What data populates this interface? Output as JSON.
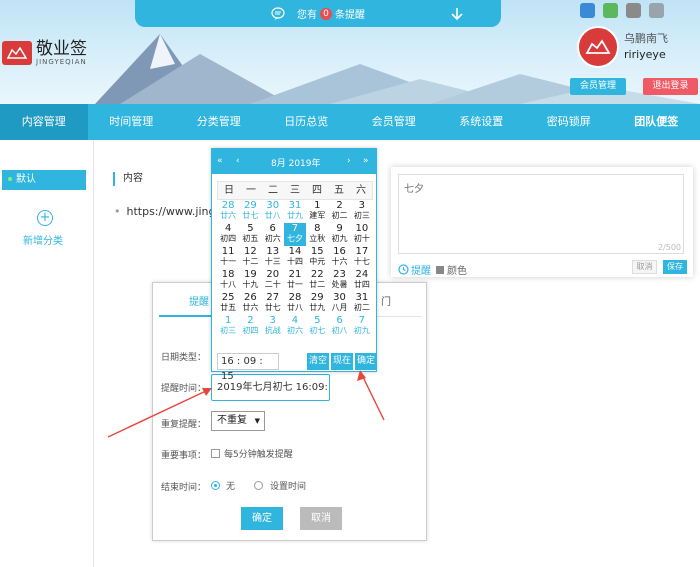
{
  "header": {
    "notice_prefix": "您有",
    "notice_count": "0",
    "notice_suffix": "条提醒",
    "logo_cn": "敬业签",
    "logo_en": "JINGYEQIAN",
    "user_name": "乌鹏南飞",
    "user_id": "ririyeye",
    "member_btn": "会员管理",
    "logout_btn": "退出登录"
  },
  "nav": {
    "items": [
      "内容管理",
      "时间管理",
      "分类管理",
      "日历总览",
      "会员管理",
      "系统设置",
      "密码锁屏",
      "团队便签"
    ]
  },
  "sidebar": {
    "default_label": "默认",
    "add_label": "新增分类"
  },
  "content": {
    "header": "内容",
    "url": "https://www.jingye"
  },
  "editor": {
    "placeholder": "七夕",
    "counter": "2/500",
    "remind": "提醒",
    "color": "颜色",
    "cancel": "取消",
    "save": "保存"
  },
  "dialog": {
    "tab1": "提醒",
    "tab2": "门",
    "date_type_label": "日期类型：",
    "remind_time_label": "提醒时间：",
    "remind_time_value": "2019年七月初七 16:09:15",
    "repeat_label": "重复提醒：",
    "repeat_value": "不重复",
    "important_label": "重要事项：",
    "important_option": "每5分钟触发提醒",
    "end_label": "结束时间：",
    "end_none": "无",
    "end_set": "设置时间",
    "ok": "确定",
    "cancel": "取消"
  },
  "calendar": {
    "month_title": "8月 2019年",
    "weekdays": [
      "日",
      "一",
      "二",
      "三",
      "四",
      "五",
      "六"
    ],
    "weeks": [
      [
        [
          "28",
          "廿六",
          "o"
        ],
        [
          "29",
          "廿七",
          "o"
        ],
        [
          "30",
          "廿八",
          "o"
        ],
        [
          "31",
          "廿九",
          "o"
        ],
        [
          "1",
          "建军",
          "c"
        ],
        [
          "2",
          "初二",
          "c"
        ],
        [
          "3",
          "初三",
          "c"
        ]
      ],
      [
        [
          "4",
          "初四",
          "c"
        ],
        [
          "5",
          "初五",
          "c"
        ],
        [
          "6",
          "初六",
          "c"
        ],
        [
          "7",
          "七夕",
          "s"
        ],
        [
          "8",
          "立秋",
          "c"
        ],
        [
          "9",
          "初九",
          "c"
        ],
        [
          "10",
          "初十",
          "c"
        ]
      ],
      [
        [
          "11",
          "十一",
          "c"
        ],
        [
          "12",
          "十二",
          "c"
        ],
        [
          "13",
          "十三",
          "c"
        ],
        [
          "14",
          "十四",
          "c"
        ],
        [
          "15",
          "中元",
          "c"
        ],
        [
          "16",
          "十六",
          "c"
        ],
        [
          "17",
          "十七",
          "c"
        ]
      ],
      [
        [
          "18",
          "十八",
          "c"
        ],
        [
          "19",
          "十九",
          "c"
        ],
        [
          "20",
          "二十",
          "c"
        ],
        [
          "21",
          "廿一",
          "c"
        ],
        [
          "22",
          "廿二",
          "c"
        ],
        [
          "23",
          "处暑",
          "c"
        ],
        [
          "24",
          "廿四",
          "c"
        ]
      ],
      [
        [
          "25",
          "廿五",
          "c"
        ],
        [
          "26",
          "廿六",
          "c"
        ],
        [
          "27",
          "廿七",
          "c"
        ],
        [
          "28",
          "廿八",
          "c"
        ],
        [
          "29",
          "廿九",
          "c"
        ],
        [
          "30",
          "八月",
          "c"
        ],
        [
          "31",
          "初二",
          "c"
        ]
      ],
      [
        [
          "1",
          "初三",
          "o"
        ],
        [
          "2",
          "初四",
          "o"
        ],
        [
          "3",
          "抗战",
          "o"
        ],
        [
          "4",
          "初六",
          "o"
        ],
        [
          "5",
          "初七",
          "o"
        ],
        [
          "6",
          "初八",
          "o"
        ],
        [
          "7",
          "初九",
          "o"
        ]
      ]
    ],
    "time": "16 : 09 : 15",
    "btn_clear": "清空",
    "btn_now": "现在",
    "btn_ok": "确定"
  }
}
